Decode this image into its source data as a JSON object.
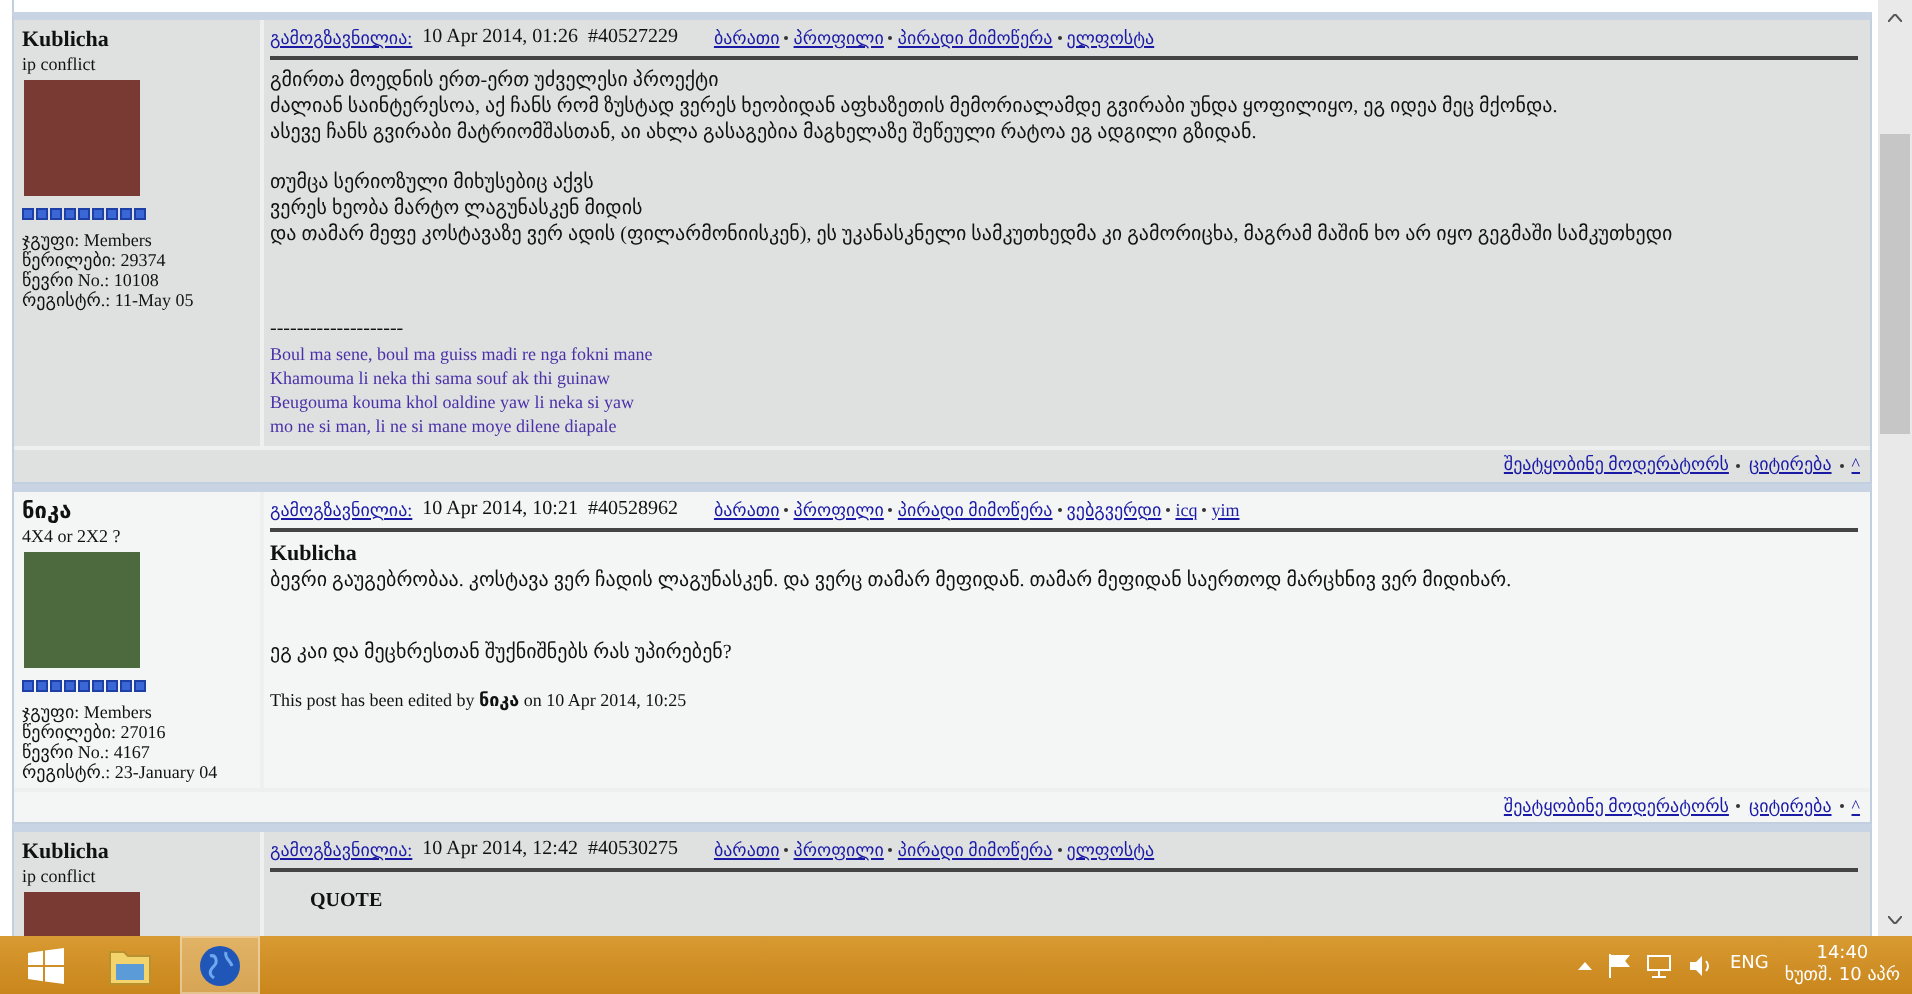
{
  "posts": [
    {
      "author": "Kublicha",
      "title": "ip conflict",
      "stats": [
        "ჯგუფი: Members",
        "წერილები: 29374",
        "წევრი No.: 10108",
        "რეგისტრ.: 11-May 05"
      ],
      "header": {
        "label": "გამოგზავნილია:",
        "date": "10 Apr 2014, 01:26",
        "number": "#40527229",
        "links": [
          "ბარათი",
          "პროფილი",
          "პირადი მიმოწერა",
          "ელფოსტა"
        ]
      },
      "body": [
        {
          "kind": "text",
          "text": "გმირთა მოედნის ერთ-ერთ უძველესი პროექტი"
        },
        {
          "kind": "text",
          "text": "ძალიან საინტერესოა, აქ ჩანს რომ ზუსტად ვერეს ხეობიდან აფხაზეთის მემორიალამდე გვირაბი უნდა ყოფილიყო, ეგ იდეა მეც მქონდა."
        },
        {
          "kind": "text",
          "text": "ასევე ჩანს გვირაბი მატრიომშასთან, აი ახლა გასაგებია მაგხელაზე შეწეული რატოა ეგ ადგილი გზიდან."
        },
        {
          "kind": "gap"
        },
        {
          "kind": "text",
          "text": "თუმცა სერიოზული მიხუსებიც აქვს"
        },
        {
          "kind": "text",
          "text": "ვერეს ხეობა მარტო ლაგუნასკენ მიდის"
        },
        {
          "kind": "text",
          "text": "და თამარ მეფე კოსტავაზე ვერ ადის (ფილარმონიისკენ), ეს უკანასკნელი სამკუთხედმა კი გამორიცხა, მაგრამ მაშინ ხო არ იყო გეგმაში სამკუთხედი"
        },
        {
          "kind": "gap"
        },
        {
          "kind": "gap"
        },
        {
          "kind": "gap"
        },
        {
          "kind": "text",
          "text": "--------------------"
        },
        {
          "kind": "signature",
          "text": "Boul ma sene, boul ma guiss madi re nga fokni mane"
        },
        {
          "kind": "signature",
          "text": "Khamouma li neka thi sama souf ak thi guinaw"
        },
        {
          "kind": "signature",
          "text": "Beugouma kouma khol oaldine yaw li neka si yaw"
        },
        {
          "kind": "signature",
          "text": "mo ne si man, li ne si mane moye dilene diapale"
        }
      ],
      "footer_links": [
        "შეატყობინე მოდერატორს",
        "ციტირება",
        "^"
      ]
    },
    {
      "author": "ნიკა",
      "title": "4X4 or 2X2 ?",
      "stats": [
        "ჯგუფი: Members",
        "წერილები: 27016",
        "წევრი No.: 4167",
        "რეგისტრ.: 23-January 04"
      ],
      "header": {
        "label": "გამოგზავნილია:",
        "date": "10 Apr 2014, 10:21",
        "number": "#40528962",
        "links": [
          "ბარათი",
          "პროფილი",
          "პირადი მიმოწერა",
          "ვებგვერდი",
          "icq",
          "yim"
        ]
      },
      "body": [
        {
          "kind": "heading",
          "text": "Kublicha"
        },
        {
          "kind": "text",
          "text": "ბევრი გაუგებრობაა. კოსტავა ვერ ჩადის ლაგუნასკენ. და ვერც თამარ მეფიდან. თამარ მეფიდან საერთოდ მარცხნივ ვერ მიდიხარ."
        },
        {
          "kind": "gap"
        },
        {
          "kind": "gap"
        },
        {
          "kind": "text",
          "text": "ეგ კაი და მეცხრესთან შუქნიშნებს რას უპირებენ?"
        },
        {
          "kind": "gap"
        },
        {
          "kind": "note",
          "text": "This post has been edited by **ნიკა** on 10 Apr 2014, 10:25"
        }
      ],
      "footer_links": [
        "შეატყობინე მოდერატორს",
        "ციტირება",
        "^"
      ]
    },
    {
      "author": "Kublicha",
      "title": "ip conflict",
      "header": {
        "label": "გამოგზავნილია:",
        "date": "10 Apr 2014, 12:42",
        "number": "#40530275",
        "links": [
          "ბარათი",
          "პროფილი",
          "პირადი მიმოწერა",
          "ელფოსტა"
        ]
      },
      "body": [
        {
          "kind": "quote",
          "text": "QUOTE"
        }
      ]
    }
  ],
  "taskbar": {
    "language": "ENG",
    "time": "14:40",
    "date": "ხუთშ. 10 აპრ"
  }
}
